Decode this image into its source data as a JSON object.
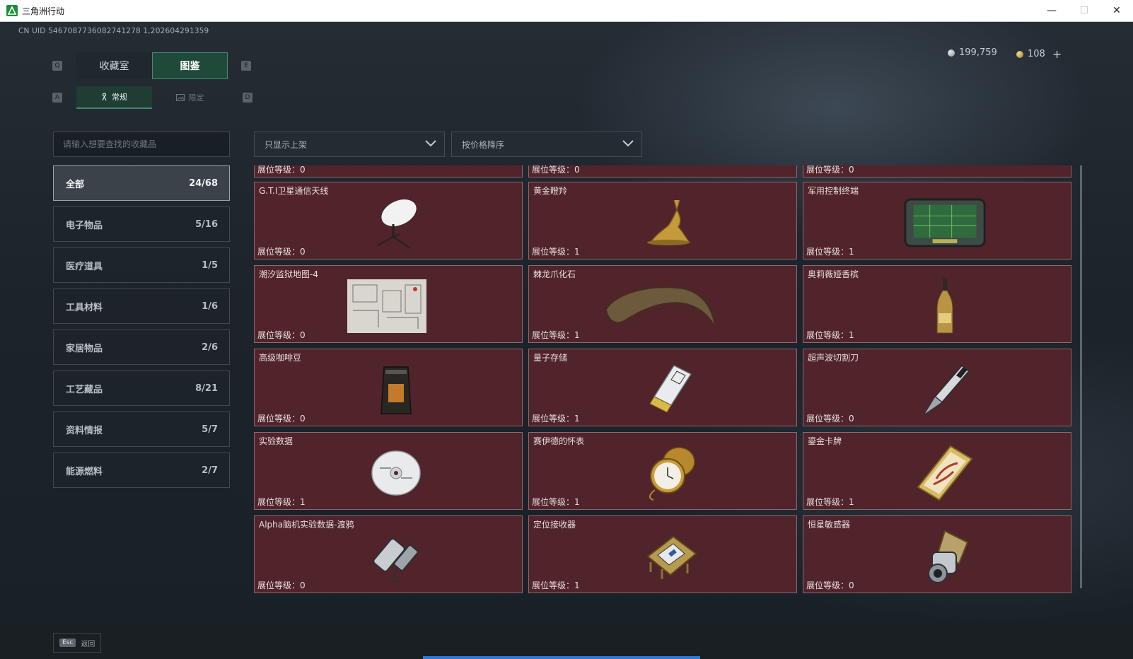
{
  "window": {
    "title": "三角洲行动",
    "minimize": "—",
    "maximize": "☐",
    "close": "✕"
  },
  "uid": "CN UID 5467087736082741278 1,202604291359",
  "currency": {
    "silver": "199,759",
    "gold": "108",
    "add": "+"
  },
  "hotkeys": {
    "tab_prev": "Q",
    "tab_next": "E",
    "sub_prev": "A",
    "sub_next": "D"
  },
  "tabs": [
    {
      "label": "收藏室"
    },
    {
      "label": "图鉴"
    }
  ],
  "subtabs": [
    {
      "label": "常规"
    },
    {
      "label": "限定"
    }
  ],
  "search": {
    "placeholder": "请输入想要查找的收藏品"
  },
  "filters": {
    "shelf": "只显示上架",
    "sort": "按价格降序"
  },
  "categories": [
    {
      "label": "全部",
      "count": "24/68"
    },
    {
      "label": "电子物品",
      "count": "5/16"
    },
    {
      "label": "医疗道具",
      "count": "1/5"
    },
    {
      "label": "工具材料",
      "count": "1/6"
    },
    {
      "label": "家居物品",
      "count": "2/6"
    },
    {
      "label": "工艺藏品",
      "count": "8/21"
    },
    {
      "label": "资料情报",
      "count": "5/7"
    },
    {
      "label": "能源燃料",
      "count": "2/7"
    }
  ],
  "partial_row": [
    {
      "level": "展位等级：0"
    },
    {
      "level": "展位等级：0"
    },
    {
      "level": "展位等级：0"
    }
  ],
  "items": [
    {
      "name": "G.T.I卫星通信天线",
      "level": "展位等级：0",
      "icon": "satellite-dish-icon"
    },
    {
      "name": "黄金瞪羚",
      "level": "展位等级：1",
      "icon": "golden-gazelle-icon"
    },
    {
      "name": "军用控制终端",
      "level": "展位等级：1",
      "icon": "military-terminal-icon"
    },
    {
      "name": "潮汐监狱地图-4",
      "level": "展位等级：0",
      "icon": "prison-map-icon"
    },
    {
      "name": "棘龙爪化石",
      "level": "展位等级：1",
      "icon": "claw-fossil-icon"
    },
    {
      "name": "奥莉薇娅香槟",
      "level": "展位等级：1",
      "icon": "champagne-bottle-icon"
    },
    {
      "name": "高级咖啡豆",
      "level": "展位等级：0",
      "icon": "coffee-bag-icon"
    },
    {
      "name": "量子存储",
      "level": "展位等级：1",
      "icon": "usb-drive-icon"
    },
    {
      "name": "超声波切割刀",
      "level": "展位等级：0",
      "icon": "ultrasonic-knife-icon"
    },
    {
      "name": "实验数据",
      "level": "展位等级：1",
      "icon": "data-disc-icon"
    },
    {
      "name": "赛伊德的怀表",
      "level": "展位等级：1",
      "icon": "pocket-watch-icon"
    },
    {
      "name": "鎏金卡牌",
      "level": "展位等级：1",
      "icon": "gold-card-icon"
    },
    {
      "name": "Alpha脑机实验数据-渡鸦",
      "level": "展位等级：0",
      "icon": "capsule-icon"
    },
    {
      "name": "定位接收器",
      "level": "展位等级：1",
      "icon": "gps-receiver-icon"
    },
    {
      "name": "恒星敏感器",
      "level": "展位等级：0",
      "icon": "star-sensor-icon"
    }
  ],
  "footer": {
    "esc_key": "Esc",
    "back_label": "返回"
  },
  "colors": {
    "card_bg": "#51232a",
    "card_border": "#8b6a6e",
    "accent_green": "#1d8f3a",
    "progress_blue": "#2f79d6"
  }
}
